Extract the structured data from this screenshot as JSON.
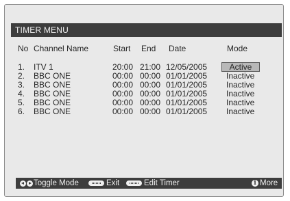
{
  "menu_title": "TIMER MENU",
  "columns": {
    "no": "No",
    "channel": "Channel Name",
    "start": "Start",
    "end": "End",
    "date": "Date",
    "mode": "Mode"
  },
  "rows": [
    {
      "no": "1.",
      "channel": "ITV 1",
      "start": "20:00",
      "end": "21:00",
      "date": "12/05/2005",
      "mode": "Active"
    },
    {
      "no": "2.",
      "channel": "BBC ONE",
      "start": "00:00",
      "end": "00:00",
      "date": "01/01/2005",
      "mode": "Inactive"
    },
    {
      "no": "3.",
      "channel": "BBC ONE",
      "start": "00:00",
      "end": "00:00",
      "date": "01/01/2005",
      "mode": "Inactive"
    },
    {
      "no": "4.",
      "channel": "BBC ONE",
      "start": "00:00",
      "end": "00:00",
      "date": "01/01/2005",
      "mode": "Inactive"
    },
    {
      "no": "5.",
      "channel": "BBC ONE",
      "start": "00:00",
      "end": "00:00",
      "date": "01/01/2005",
      "mode": "Inactive"
    },
    {
      "no": "6.",
      "channel": "BBC ONE",
      "start": "00:00",
      "end": "00:00",
      "date": "01/01/2005",
      "mode": "Inactive"
    }
  ],
  "footer": {
    "toggle_label": "Toggle Mode",
    "exit_label": "Exit",
    "edit_label": "Edit Timer",
    "more_label": "More"
  },
  "colors": {
    "bar": "#3d3d3d",
    "panel": "#e9e9e9",
    "highlight": "#b8b8b8"
  }
}
